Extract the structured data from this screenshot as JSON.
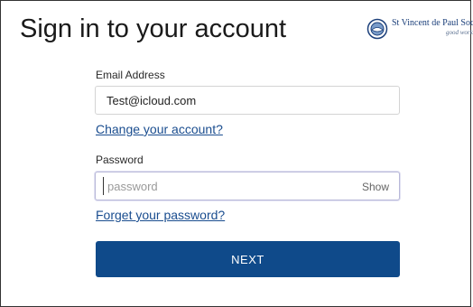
{
  "header": {
    "title": "Sign in to your account"
  },
  "logo": {
    "name": "St Vincent de Paul Society",
    "tagline": "good works",
    "icon": "svdp-logo-icon"
  },
  "form": {
    "email_label": "Email Address",
    "email_value": "Test@icloud.com",
    "change_account_link": "Change your account?",
    "password_label": "Password",
    "password_placeholder": "password",
    "show_label": "Show",
    "forgot_password_link": "Forget your password?",
    "next_label": "NEXT"
  },
  "colors": {
    "primary": "#0f4a8a",
    "link": "#1a4d8f",
    "brand": "#1b3f7a"
  }
}
